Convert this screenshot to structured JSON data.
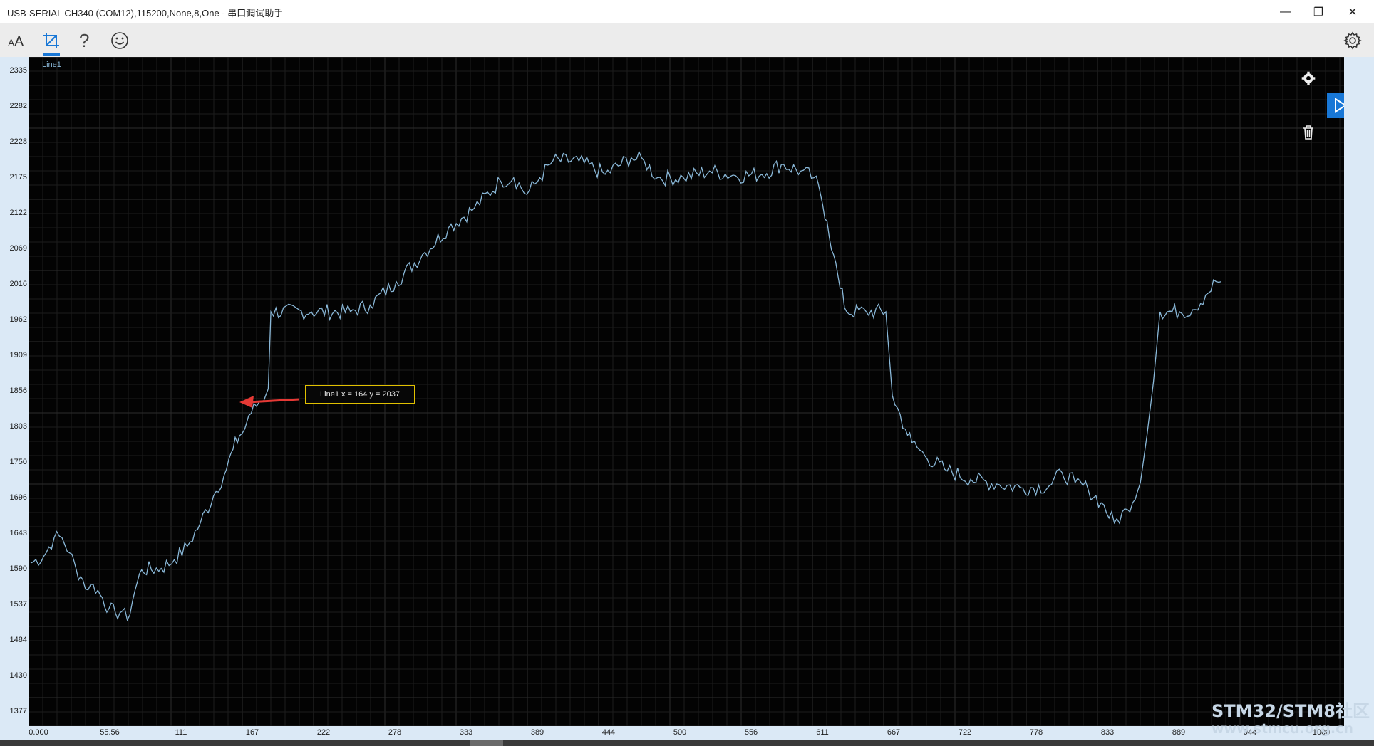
{
  "window": {
    "title": "USB-SERIAL CH340 (COM12),115200,None,8,One - 串口调试助手",
    "controls": {
      "minimize": "—",
      "restore": "❐",
      "close": "✕"
    }
  },
  "toolbar": {
    "items": [
      {
        "name": "font-size-icon",
        "glyph": "A"
      },
      {
        "name": "crop-icon"
      },
      {
        "name": "help-icon",
        "glyph": "?"
      },
      {
        "name": "smiley-icon"
      }
    ],
    "settings_icon": "gear-icon"
  },
  "side_controls": [
    "gear-icon",
    "play-icon",
    "trash-icon"
  ],
  "tooltip": {
    "text": "Line1  x = 164  y = 2037"
  },
  "watermark": {
    "line1": "STM32/STM8社区",
    "line2": "www.stmcu.org.cn"
  },
  "chart_data": {
    "type": "line",
    "series": [
      {
        "name": "Line1",
        "color": "#8ab8d8"
      }
    ],
    "x_tick_labels": [
      "0.000",
      "55.56",
      "111",
      "167",
      "222",
      "278",
      "333",
      "389",
      "444",
      "500",
      "556",
      "611",
      "667",
      "722",
      "778",
      "833",
      "889",
      "944",
      "1000"
    ],
    "y_tick_labels": [
      "2335",
      "2282",
      "2228",
      "2175",
      "2122",
      "2069",
      "2016",
      "1962",
      "1909",
      "1856",
      "1803",
      "1750",
      "1696",
      "1643",
      "1590",
      "1537",
      "1484",
      "1430",
      "1377"
    ],
    "xlim": [
      0,
      1000
    ],
    "ylim": [
      1377,
      2335
    ],
    "grid": true,
    "legend_position": "top-left",
    "points": [
      [
        0,
        1600
      ],
      [
        10,
        1610
      ],
      [
        18,
        1638
      ],
      [
        24,
        1638
      ],
      [
        30,
        1615
      ],
      [
        35,
        1590
      ],
      [
        40,
        1575
      ],
      [
        44,
        1560
      ],
      [
        48,
        1568
      ],
      [
        55,
        1548
      ],
      [
        60,
        1532
      ],
      [
        65,
        1525
      ],
      [
        70,
        1528
      ],
      [
        74,
        1515
      ],
      [
        80,
        1560
      ],
      [
        85,
        1590
      ],
      [
        100,
        1592
      ],
      [
        110,
        1605
      ],
      [
        120,
        1625
      ],
      [
        130,
        1660
      ],
      [
        140,
        1700
      ],
      [
        150,
        1740
      ],
      [
        155,
        1770
      ],
      [
        160,
        1790
      ],
      [
        164,
        1800
      ],
      [
        167,
        1820
      ],
      [
        175,
        1840
      ],
      [
        180,
        1850
      ],
      [
        182,
        1860
      ],
      [
        184,
        1975
      ],
      [
        215,
        1975
      ],
      [
        245,
        1975
      ],
      [
        260,
        1985
      ],
      [
        280,
        2020
      ],
      [
        300,
        2060
      ],
      [
        320,
        2100
      ],
      [
        340,
        2130
      ],
      [
        360,
        2170
      ],
      [
        370,
        2175
      ],
      [
        380,
        2150
      ],
      [
        390,
        2175
      ],
      [
        400,
        2200
      ],
      [
        420,
        2200
      ],
      [
        440,
        2180
      ],
      [
        460,
        2205
      ],
      [
        470,
        2200
      ],
      [
        480,
        2175
      ],
      [
        500,
        2175
      ],
      [
        520,
        2185
      ],
      [
        540,
        2178
      ],
      [
        560,
        2180
      ],
      [
        575,
        2195
      ],
      [
        590,
        2185
      ],
      [
        600,
        2175
      ],
      [
        605,
        2150
      ],
      [
        610,
        2110
      ],
      [
        615,
        2060
      ],
      [
        620,
        2010
      ],
      [
        625,
        1975
      ],
      [
        640,
        1975
      ],
      [
        655,
        1975
      ],
      [
        660,
        1850
      ],
      [
        670,
        1800
      ],
      [
        675,
        1780
      ],
      [
        685,
        1760
      ],
      [
        700,
        1740
      ],
      [
        720,
        1725
      ],
      [
        740,
        1718
      ],
      [
        760,
        1712
      ],
      [
        780,
        1715
      ],
      [
        790,
        1735
      ],
      [
        800,
        1720
      ],
      [
        810,
        1710
      ],
      [
        820,
        1690
      ],
      [
        830,
        1660
      ],
      [
        840,
        1680
      ],
      [
        850,
        1720
      ],
      [
        855,
        1790
      ],
      [
        860,
        1870
      ],
      [
        865,
        1975
      ],
      [
        880,
        1975
      ],
      [
        890,
        1978
      ],
      [
        900,
        2000
      ],
      [
        908,
        2020
      ],
      [
        912,
        2020
      ]
    ]
  }
}
